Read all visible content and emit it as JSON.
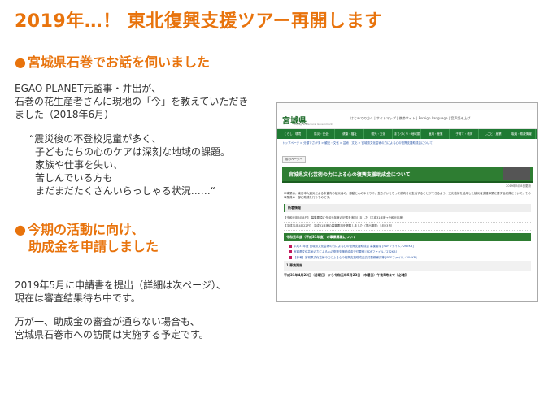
{
  "title": "2019年…！ 東北復興支援ツアー再開します",
  "section1": {
    "bullet": "●",
    "heading": "宮城県石巻でお話を伺いました",
    "intro": [
      "EGAO PLANET元監事・井出が、",
      "石巻の花生産者さんに現地の「今」を教えていただき",
      "ました（2018年6月）"
    ],
    "quote": [
      "“震災後の不登校児童が多く、",
      "子どもたちの心のケアは深刻な地域の課題。",
      "家族や仕事を失い、",
      "苦しんでいる方も",
      "まだまだたくさんいらっしゃる状況……“"
    ]
  },
  "section2": {
    "bullet": "●",
    "heading_line1": "今期の活動に向け、",
    "heading_line2": "助成金を申請しました",
    "para1": [
      "2019年5月に申請書を提出（詳細は次ページ）、",
      "現在は審査結果待ち中です。"
    ],
    "para2": [
      "万が一、助成金の審査が通らない場合も、",
      "宮城県石巻市への訪問は実施する予定です。"
    ]
  },
  "screenshot": {
    "logo": "宮城県",
    "logo_sub": "Miyagi Prefectural Government",
    "top_links": "はじめての方へ | サイトマップ | 携帯サイト | Foreign Language | 音声読み上げ",
    "nav": [
      "くらし・環境",
      "防災・安全",
      "健康・福祉",
      "観光・文化",
      "まちづくり・地域振興",
      "雇用・産業",
      "子育て・教育",
      "しごと・産業",
      "取組・県政情報"
    ],
    "breadcrumb": "トップページ > 分類でさがす > 観光・文化 > 芸術・文化 > 宮城県文化芸術の力による心の復興支援助成金について",
    "button": "前のページへ",
    "banner": "宮城県文化芸術の力による心の復興支援助成金について",
    "updated": "2019年5月8日更新",
    "body": "本事業は，東日本大震災による未曾有の被災者の、感動と心のゆとりや、生きがいをもって前向きに生活することができるよう、文化芸術を活用した被災者支援事業に要する経費について，その事業費の一部に助成を行うものです。",
    "news_heading": "新着情報",
    "news": [
      "【令和元年5月8日】 募集要項に令和元年度の記載を追加しました（平成31年度→令和元年度）",
      "【平成31年4月22日】 平成31年度の募集要項を掲載しました（提出期限：5月23日）"
    ],
    "green_heading": "令和元年度（平成31年度）の事業募集について",
    "docs": [
      "平成31年度 宮城県文化芸術の力による心の復興支援助成金 募集要項 [PDFファイル／267KB]",
      "宮城県文化芸術の力による心の復興支援助成金交付要綱 [PDFファイル／272KB]",
      "【参考】宮城県文化芸術の力による心の復興支援助成金交付要綱様式等 [PDFファイル／504KB]"
    ],
    "section_label": "1 募集期間",
    "period": "平成31年4月22日（月曜日）から令和元年5月23日（木曜日）午後5時まで【必着】"
  }
}
